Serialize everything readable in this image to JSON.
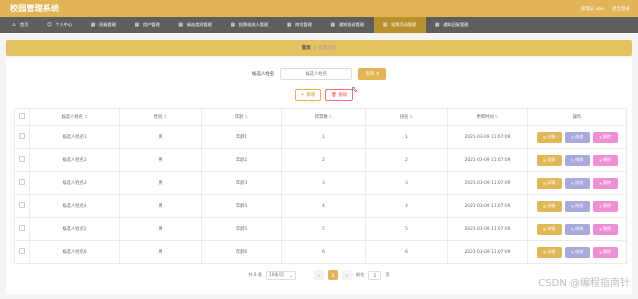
{
  "header": {
    "title": "校园管理系统",
    "user_label": "管理员 abo",
    "logout_label": "退出登录"
  },
  "nav": {
    "items": [
      {
        "icon": "home-icon",
        "label": "首页"
      },
      {
        "icon": "user-icon",
        "label": "个人中心"
      },
      {
        "icon": "grid-icon",
        "label": "班级管理"
      },
      {
        "icon": "grid-icon",
        "label": "用户管理"
      },
      {
        "icon": "grid-icon",
        "label": "候选类别管理"
      },
      {
        "icon": "grid-icon",
        "label": "投票候选人管理"
      },
      {
        "icon": "grid-icon",
        "label": "岗位管理"
      },
      {
        "icon": "grid-icon",
        "label": "通知投诉管理"
      },
      {
        "icon": "grid-icon",
        "label": "投票活动管理"
      },
      {
        "icon": "grid-icon",
        "label": "通知回复管理"
      }
    ],
    "active_index": 8
  },
  "breadcrumb": {
    "home": "首页",
    "separator": "/",
    "current": "投票活动"
  },
  "search": {
    "label": "候选人姓名",
    "placeholder": "候选人姓名",
    "button_label": "查询"
  },
  "actions": {
    "add_label": "新增",
    "delete_label": "删除"
  },
  "table": {
    "columns": [
      "候选人姓名",
      "性别",
      "年龄",
      "得票数",
      "排名",
      "更新时间",
      "操作"
    ],
    "rows": [
      {
        "name": "候选人姓名1",
        "gender": "男",
        "age": "年龄1",
        "votes": "1",
        "rank": "1",
        "updated": "2021-03-09 11:07:09"
      },
      {
        "name": "候选人姓名2",
        "gender": "男",
        "age": "年龄2",
        "votes": "2",
        "rank": "2",
        "updated": "2021-03-09 11:07:09"
      },
      {
        "name": "候选人姓名3",
        "gender": "男",
        "age": "年龄3",
        "votes": "3",
        "rank": "3",
        "updated": "2021-03-09 11:07:09"
      },
      {
        "name": "候选人姓名4",
        "gender": "男",
        "age": "年龄4",
        "votes": "4",
        "rank": "4",
        "updated": "2021-03-09 11:07:09"
      },
      {
        "name": "候选人姓名5",
        "gender": "男",
        "age": "年龄5",
        "votes": "5",
        "rank": "5",
        "updated": "2021-03-09 11:07:09"
      },
      {
        "name": "候选人姓名6",
        "gender": "男",
        "age": "年龄6",
        "votes": "6",
        "rank": "6",
        "updated": "2021-03-09 11:07:09"
      }
    ],
    "op_detail": "详情",
    "op_edit": "修改",
    "op_delete": "删除"
  },
  "pagination": {
    "total_label": "共 6 条",
    "page_size_label": "10条/页",
    "prev": "<",
    "current_page": "1",
    "next": ">",
    "goto_label": "前往",
    "goto_value": "1",
    "page_suffix": "页"
  },
  "watermark": "CSDN @编程指南针",
  "colors": {
    "accent": "#e2b456",
    "nav_bg": "#5f5e5c",
    "nav_active": "#b8912e",
    "detail": "#e0b85a",
    "edit": "#a9a9dc",
    "delete": "#ee8fd5"
  }
}
